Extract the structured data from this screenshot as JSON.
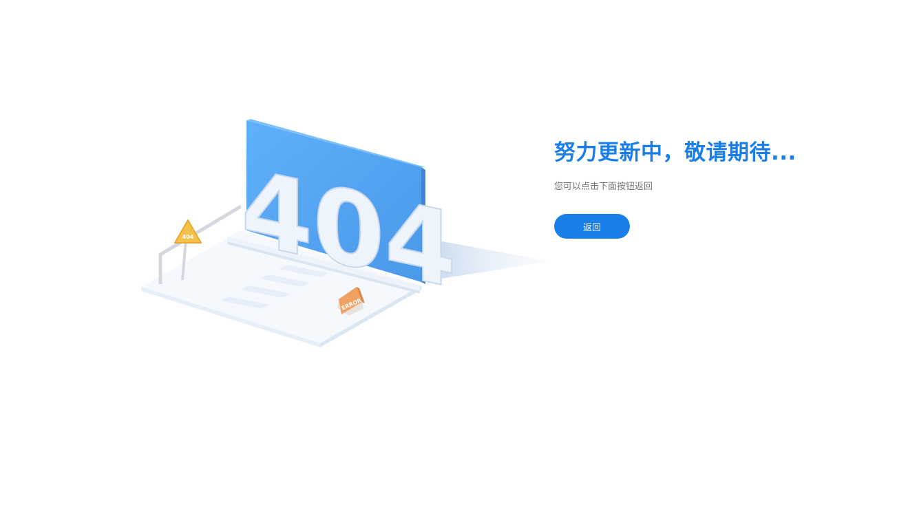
{
  "illustration": {
    "big_number": "404",
    "sign_text": "404",
    "board_text": "ERROR"
  },
  "message": {
    "title": "努力更新中，敬请期待...",
    "subtitle": "您可以点击下面按钮返回",
    "back_button_label": "返回"
  },
  "colors": {
    "accent": "#1a7ee8",
    "panel_blue": "#5aa8f5",
    "warning_yellow": "#f5c04a",
    "error_orange": "#f0a060"
  }
}
